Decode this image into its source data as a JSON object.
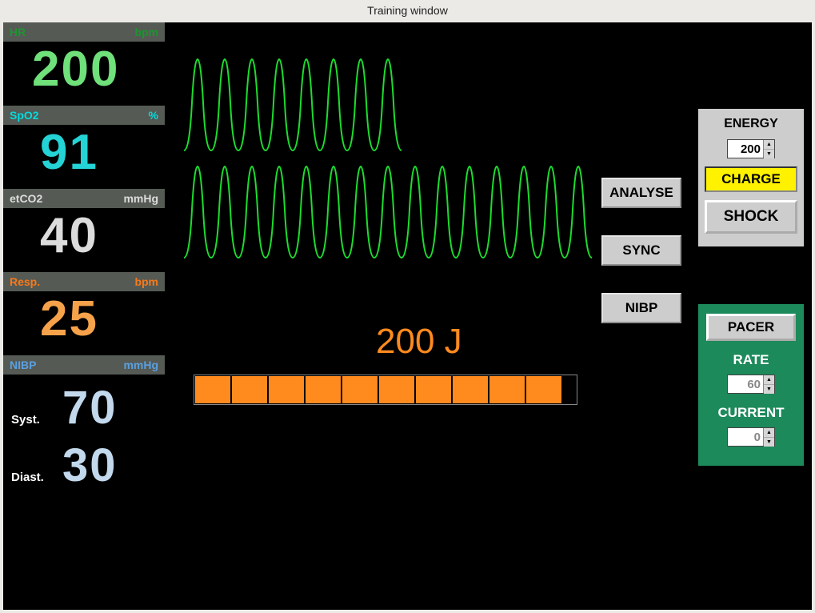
{
  "window": {
    "title": "Training window"
  },
  "vitals": {
    "hr": {
      "label": "HR",
      "unit": "bpm",
      "value": "200"
    },
    "spo2": {
      "label": "SpO2",
      "unit": "%",
      "value": "91"
    },
    "etco2": {
      "label": "etCO2",
      "unit": "mmHg",
      "value": "40"
    },
    "resp": {
      "label": "Resp.",
      "unit": "bpm",
      "value": "25"
    },
    "nibp": {
      "label": "NIBP",
      "unit": "mmHg",
      "syst_label": "Syst.",
      "syst_value": "70",
      "diast_label": "Diast.",
      "diast_value": "30"
    }
  },
  "center": {
    "energy_text": "200 J",
    "charge_segments_total": 10,
    "charge_segments_on": 10
  },
  "mid_buttons": {
    "analyse": "ANALYSE",
    "sync": "SYNC",
    "nibp": "NIBP"
  },
  "defib": {
    "energy_label": "ENERGY",
    "energy_value": "200",
    "charge_label": "CHARGE",
    "shock_label": "SHOCK"
  },
  "pacer": {
    "pacer_label": "PACER",
    "rate_label": "RATE",
    "rate_value": "60",
    "current_label": "CURRENT",
    "current_value": "0"
  },
  "colors": {
    "hr": "#6fe07a",
    "spo2": "#24d3d5",
    "etco2": "#dcdcdc",
    "resp": "#f5a24b",
    "nibp": "#c2d8ec",
    "orange": "#ff8a1e",
    "yellow": "#fff200",
    "pacer_bg": "#1d8a5b"
  }
}
